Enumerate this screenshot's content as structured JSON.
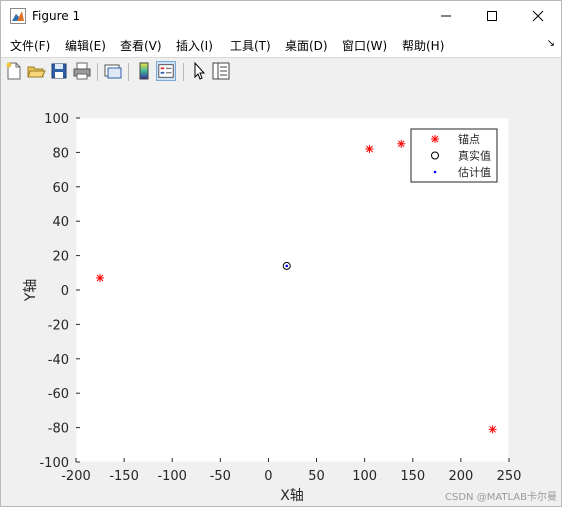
{
  "window": {
    "title": "Figure 1"
  },
  "menu": {
    "items": [
      "文件(F)",
      "编辑(E)",
      "查看(V)",
      "插入(I)",
      "工具(T)",
      "桌面(D)",
      "窗口(W)",
      "帮助(H)"
    ]
  },
  "toolbar": {
    "buttons": [
      "new-figure-icon",
      "open-file-icon",
      "save-icon",
      "print-icon",
      "link-plot-icon",
      "insert-colorbar-icon",
      "insert-legend-icon",
      "pointer-icon",
      "property-inspector-icon"
    ]
  },
  "colors": {
    "anchor": "#ff0000",
    "true_value": "#000000",
    "estimate": "#0000ff",
    "plot_bg": "#ffffff",
    "figure_bg": "#f0f0f0"
  },
  "chart_data": {
    "type": "scatter",
    "xlabel": "X轴",
    "ylabel": "Y轴",
    "xlim": [
      -200,
      250
    ],
    "ylim": [
      -100,
      100
    ],
    "xticks": [
      -200,
      -150,
      -100,
      -50,
      0,
      50,
      100,
      150,
      200,
      250
    ],
    "yticks": [
      -100,
      -80,
      -60,
      -40,
      -20,
      0,
      20,
      40,
      60,
      80,
      100
    ],
    "grid": false,
    "legend_position": "top-right",
    "series": [
      {
        "name": "锚点",
        "marker": "asterisk",
        "color": "#ff0000",
        "points": [
          [
            -175,
            7
          ],
          [
            105,
            82
          ],
          [
            138,
            85
          ],
          [
            233,
            -81
          ]
        ]
      },
      {
        "name": "真实值",
        "marker": "circle",
        "color": "#000000",
        "points": [
          [
            19,
            14
          ]
        ]
      },
      {
        "name": "估计值",
        "marker": "dot",
        "color": "#0000ff",
        "points": [
          [
            19,
            14
          ]
        ]
      }
    ]
  },
  "watermark": "CSDN @MATLAB卡尔曼"
}
